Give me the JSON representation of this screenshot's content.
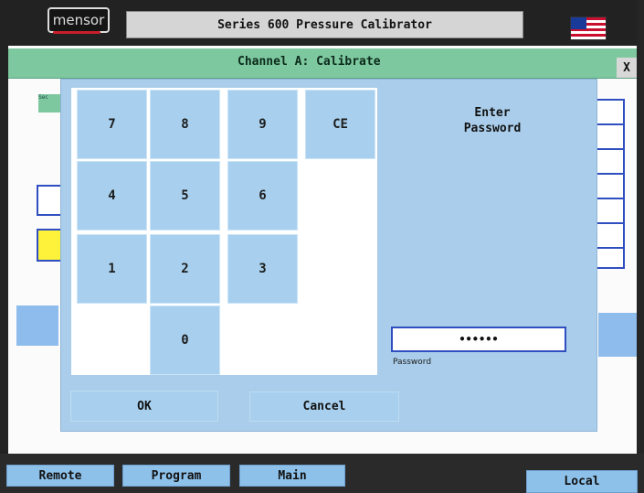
{
  "header": {
    "logo_text": "mensor",
    "title": "Series 600 Pressure Calibrator",
    "flag_icon": "us-flag-icon"
  },
  "channel": {
    "title": "Channel A: Calibrate",
    "close_label": "X"
  },
  "background": {
    "left_tab_label": "Sec"
  },
  "keypad": {
    "keys": [
      "7",
      "8",
      "9",
      "CE",
      "4",
      "5",
      "6",
      "1",
      "2",
      "3",
      "0"
    ]
  },
  "password_panel": {
    "prompt_line1": "Enter",
    "prompt_line2": "Password",
    "value": "••••••",
    "field_label": "Password"
  },
  "dialog_buttons": {
    "ok_label": "OK",
    "cancel_label": "Cancel"
  },
  "bottom_nav": {
    "remote_label": "Remote",
    "program_label": "Program",
    "main_label": "Main",
    "local_label": "Local"
  },
  "colors": {
    "channel_bar": "#7ec8a0",
    "dialog_bg": "#a9cdea",
    "key_bg": "#a8d0ee",
    "field_border": "#2f4ec0"
  }
}
